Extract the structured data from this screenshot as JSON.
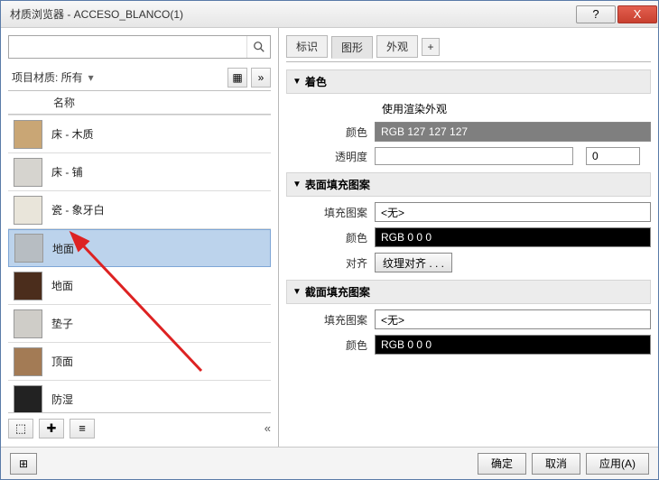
{
  "window": {
    "title": "材质浏览器 - ACCESO_BLANCO(1)",
    "help": "?",
    "close": "X"
  },
  "search": {
    "placeholder": "",
    "icon": "search-icon"
  },
  "filter": {
    "label": "项目材质: 所有",
    "arrow": "▾",
    "viewIcon": "▦",
    "moreIcon": "»"
  },
  "list": {
    "header": "名称",
    "items": [
      {
        "name": "床 - 木质",
        "color": "#c9a675"
      },
      {
        "name": "床 - 铺",
        "color": "#d6d4cf"
      },
      {
        "name": "瓷 - 象牙白",
        "color": "#e9e5da"
      },
      {
        "name": "地面",
        "color": "#b7bdc2",
        "selected": true
      },
      {
        "name": "地面",
        "color": "#4b2d1c"
      },
      {
        "name": "垫子",
        "color": "#cfcdc8"
      },
      {
        "name": "顶面",
        "color": "#a37b55"
      },
      {
        "name": "防湿",
        "color": "#222222"
      }
    ]
  },
  "leftToolbar": {
    "b1": "⬚",
    "b2": "✚",
    "b3": "≡",
    "expand": "«"
  },
  "tabs": {
    "items": [
      "标识",
      "图形",
      "外观"
    ],
    "active": 1,
    "add": "+"
  },
  "shading": {
    "title": "着色",
    "useRender": "使用渲染外观",
    "colorLabel": "颜色",
    "colorValue": "RGB 127 127 127",
    "transparencyLabel": "透明度",
    "transparencyValue": "0"
  },
  "surface": {
    "title": "表面填充图案",
    "patternLabel": "填充图案",
    "patternValue": "<无>",
    "colorLabel": "颜色",
    "colorValue": "RGB 0 0 0",
    "alignLabel": "对齐",
    "alignBtn": "纹理对齐 . . ."
  },
  "cut": {
    "title": "截面填充图案",
    "patternLabel": "填充图案",
    "patternValue": "<无>",
    "colorLabel": "颜色",
    "colorValue": "RGB 0 0 0"
  },
  "footer": {
    "iconBtn": "⊞",
    "ok": "确定",
    "cancel": "取消",
    "apply": "应用(A)"
  }
}
